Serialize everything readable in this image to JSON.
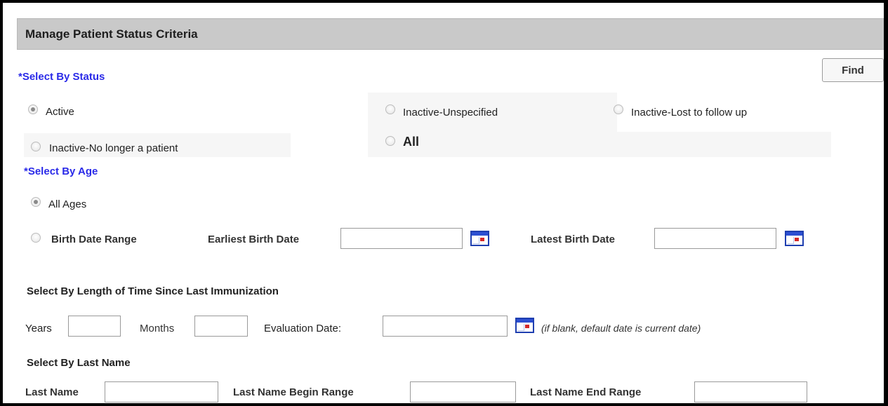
{
  "header": {
    "title": "Manage Patient Status Criteria"
  },
  "find_button": "Find",
  "status_section": {
    "label": "*Select By Status",
    "options": [
      {
        "label": "Active",
        "checked": true
      },
      {
        "label": "Inactive-Unspecified",
        "checked": false
      },
      {
        "label": "Inactive-Lost to follow up",
        "checked": false
      },
      {
        "label": "Inactive-No longer a patient",
        "checked": false
      },
      {
        "label": "All",
        "checked": false
      }
    ]
  },
  "age_section": {
    "label": "*Select By Age",
    "options": [
      {
        "label": "All Ages",
        "checked": true
      },
      {
        "label": "Birth Date Range",
        "checked": false
      }
    ],
    "earliest_label": "Earliest Birth Date",
    "earliest_value": "",
    "latest_label": "Latest Birth Date",
    "latest_value": ""
  },
  "immunization_section": {
    "label": "Select By Length of Time Since Last Immunization",
    "years_label": "Years",
    "years_value": "",
    "months_label": "Months",
    "months_value": "",
    "eval_label": "Evaluation Date:",
    "eval_value": "",
    "note": "(if blank, default date is current date)"
  },
  "name_section": {
    "label": "Select By Last Name",
    "last_name_label": "Last Name",
    "last_name_value": "",
    "begin_label": "Last Name Begin Range",
    "begin_value": "",
    "end_label": "Last Name End Range",
    "end_value": ""
  },
  "icons": {
    "calendar": "calendar-icon"
  },
  "colors": {
    "required_label": "#2a2ae8",
    "header_bg": "#c9c9c9",
    "calendar_blue": "#1f3fb0"
  }
}
